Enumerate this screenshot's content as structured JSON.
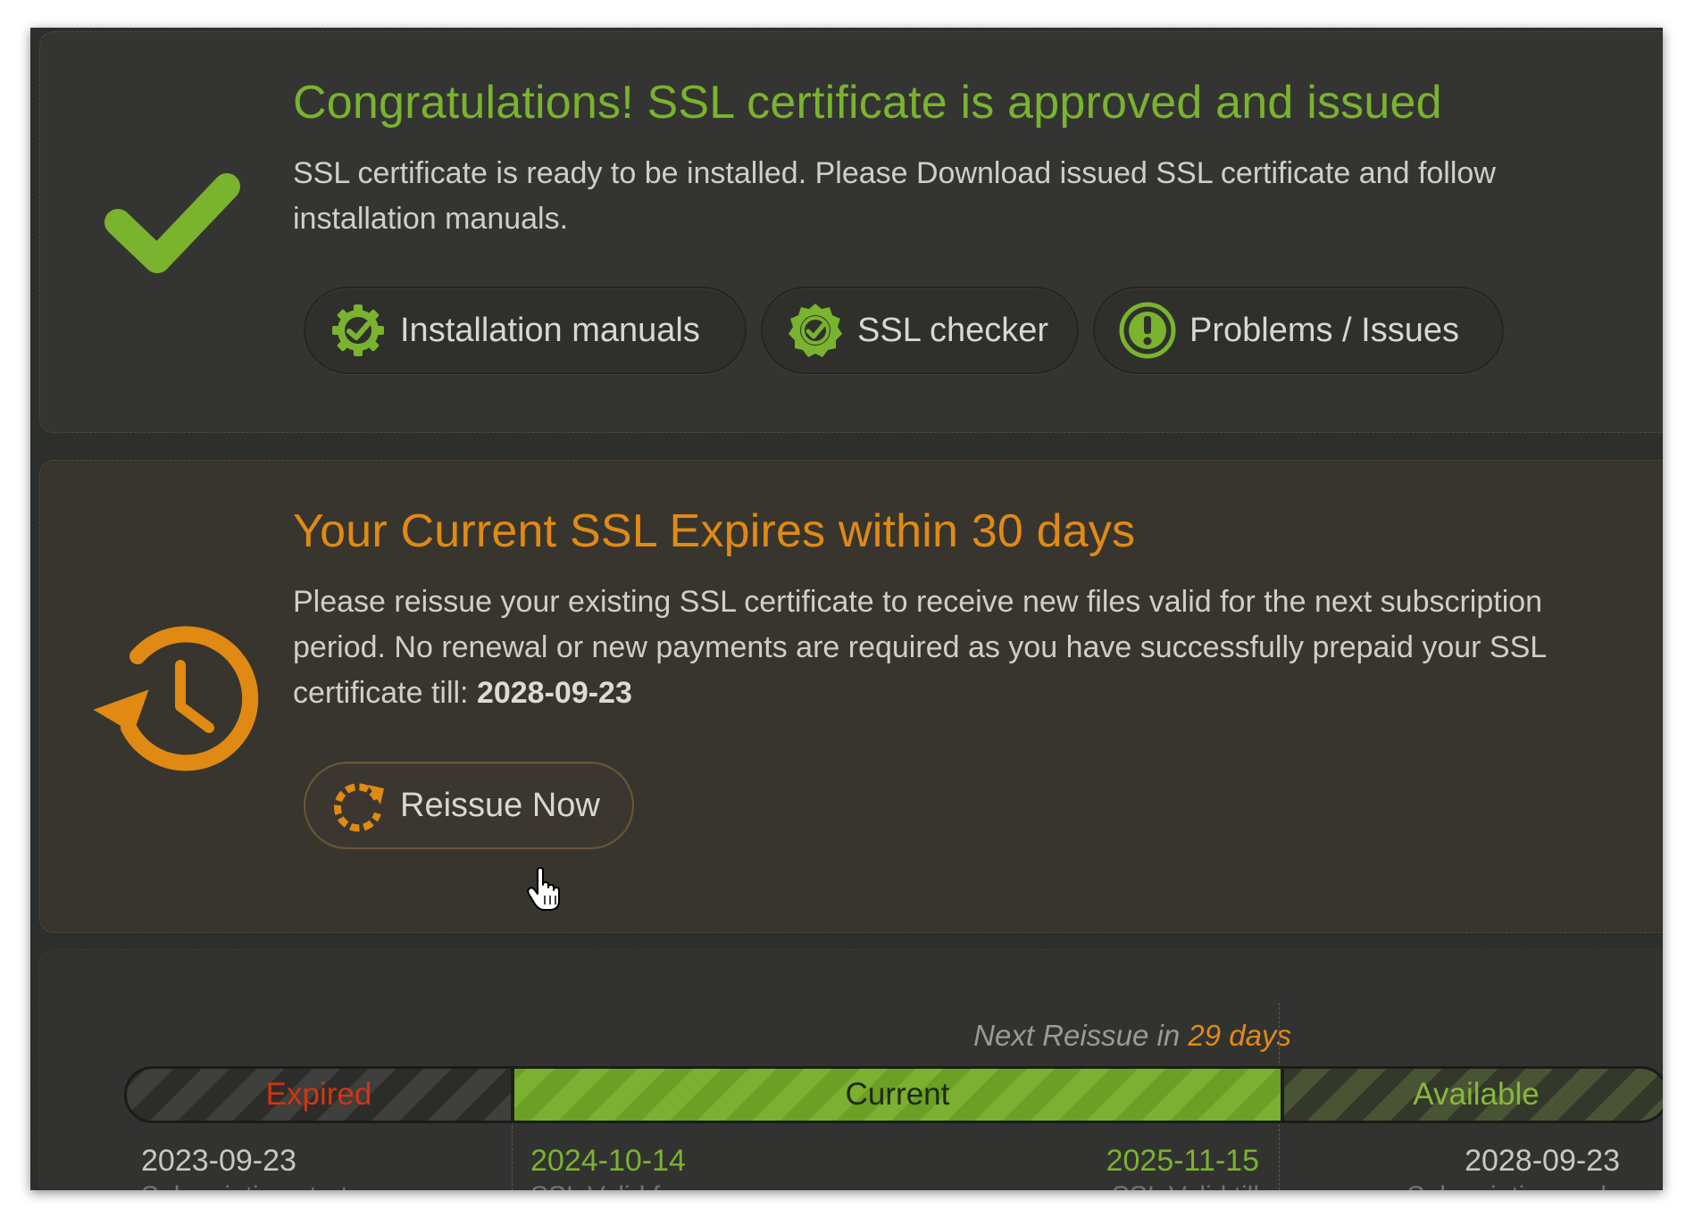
{
  "approved": {
    "title": "Congratulations! SSL certificate is approved and issued",
    "text": "SSL certificate is ready to be installed. Please Download issued SSL certificate and follow installation manuals.",
    "buttons": {
      "manuals": "Installation manuals",
      "checker": "SSL checker",
      "problems": "Problems / Issues"
    }
  },
  "expiry": {
    "title": "Your Current SSL Expires within 30 days",
    "text": "Please reissue your existing SSL certificate to receive new files valid for the next subscription period. No renewal or new payments are required as you have successfully prepaid your SSL certificate till: ",
    "prepaid_date": "2028-09-23",
    "reissue_label": "Reissue Now"
  },
  "timeline": {
    "next_prefix": "Next Reissue in ",
    "next_days": "29 days",
    "segments": {
      "expired": "Expired",
      "current": "Current",
      "available": "Available"
    },
    "subscription_start": {
      "date": "2023-09-23",
      "label": "Subscription starts"
    },
    "valid_from": {
      "date": "2024-10-14",
      "label": "SSL Valid from"
    },
    "valid_till": {
      "date": "2025-11-15",
      "label": "SSL Valid till"
    },
    "subscription_end": {
      "date": "2028-09-23",
      "label": "Subscription ends"
    }
  },
  "colors": {
    "green": "#7ab32e",
    "orange": "#e08a13",
    "red": "#d33412",
    "background": "#2d2f2c"
  },
  "icons": {
    "approved": "checkmark-icon",
    "manuals": "gear-icon",
    "checker": "badge-check-icon",
    "problems": "exclamation-icon",
    "expiry": "history-clock-icon",
    "reissue": "refresh-icon"
  }
}
